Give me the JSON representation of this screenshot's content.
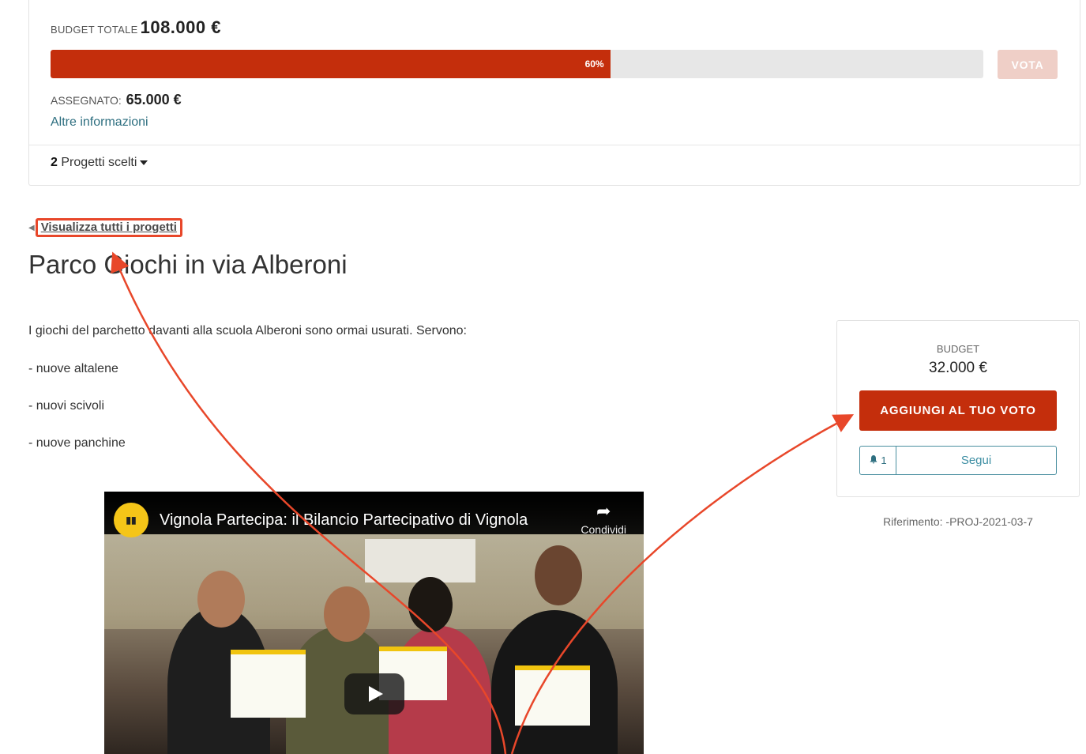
{
  "budget": {
    "total_label": "BUDGET TOTALE",
    "total_value": "108.000 €",
    "progress_label": "60%",
    "progress_value": 0.6,
    "vote_button": "VOTA",
    "assigned_label": "ASSEGNATO:",
    "assigned_value": "65.000 €",
    "more_info": "Altre informazioni",
    "chosen_count": "2",
    "chosen_label": "Progetti scelti"
  },
  "nav": {
    "back_link": "Visualizza tutti i progetti"
  },
  "project": {
    "title": "Parco Giochi in via Alberoni",
    "description": [
      "I giochi del parchetto davanti alla scuola Alberoni sono ormai usurati. Servono:",
      "- nuove altalene",
      "- nuovi scivoli",
      "- nuove panchine"
    ]
  },
  "sidebar": {
    "budget_label": "BUDGET",
    "budget_value": "32.000 €",
    "add_vote_button": "AGGIUNGI AL TUO VOTO",
    "follow_count": "1",
    "follow_button": "Segui",
    "reference": "Riferimento: -PROJ-2021-03-7"
  },
  "video": {
    "title": "Vignola Partecipa: il Bilancio Partecipativo di Vignola",
    "share_label": "Condividi"
  },
  "colors": {
    "primary": "#c42e0c",
    "vote_disabled": "#efcfc7",
    "link": "#2e6f80",
    "annotation": "#e8472a"
  }
}
